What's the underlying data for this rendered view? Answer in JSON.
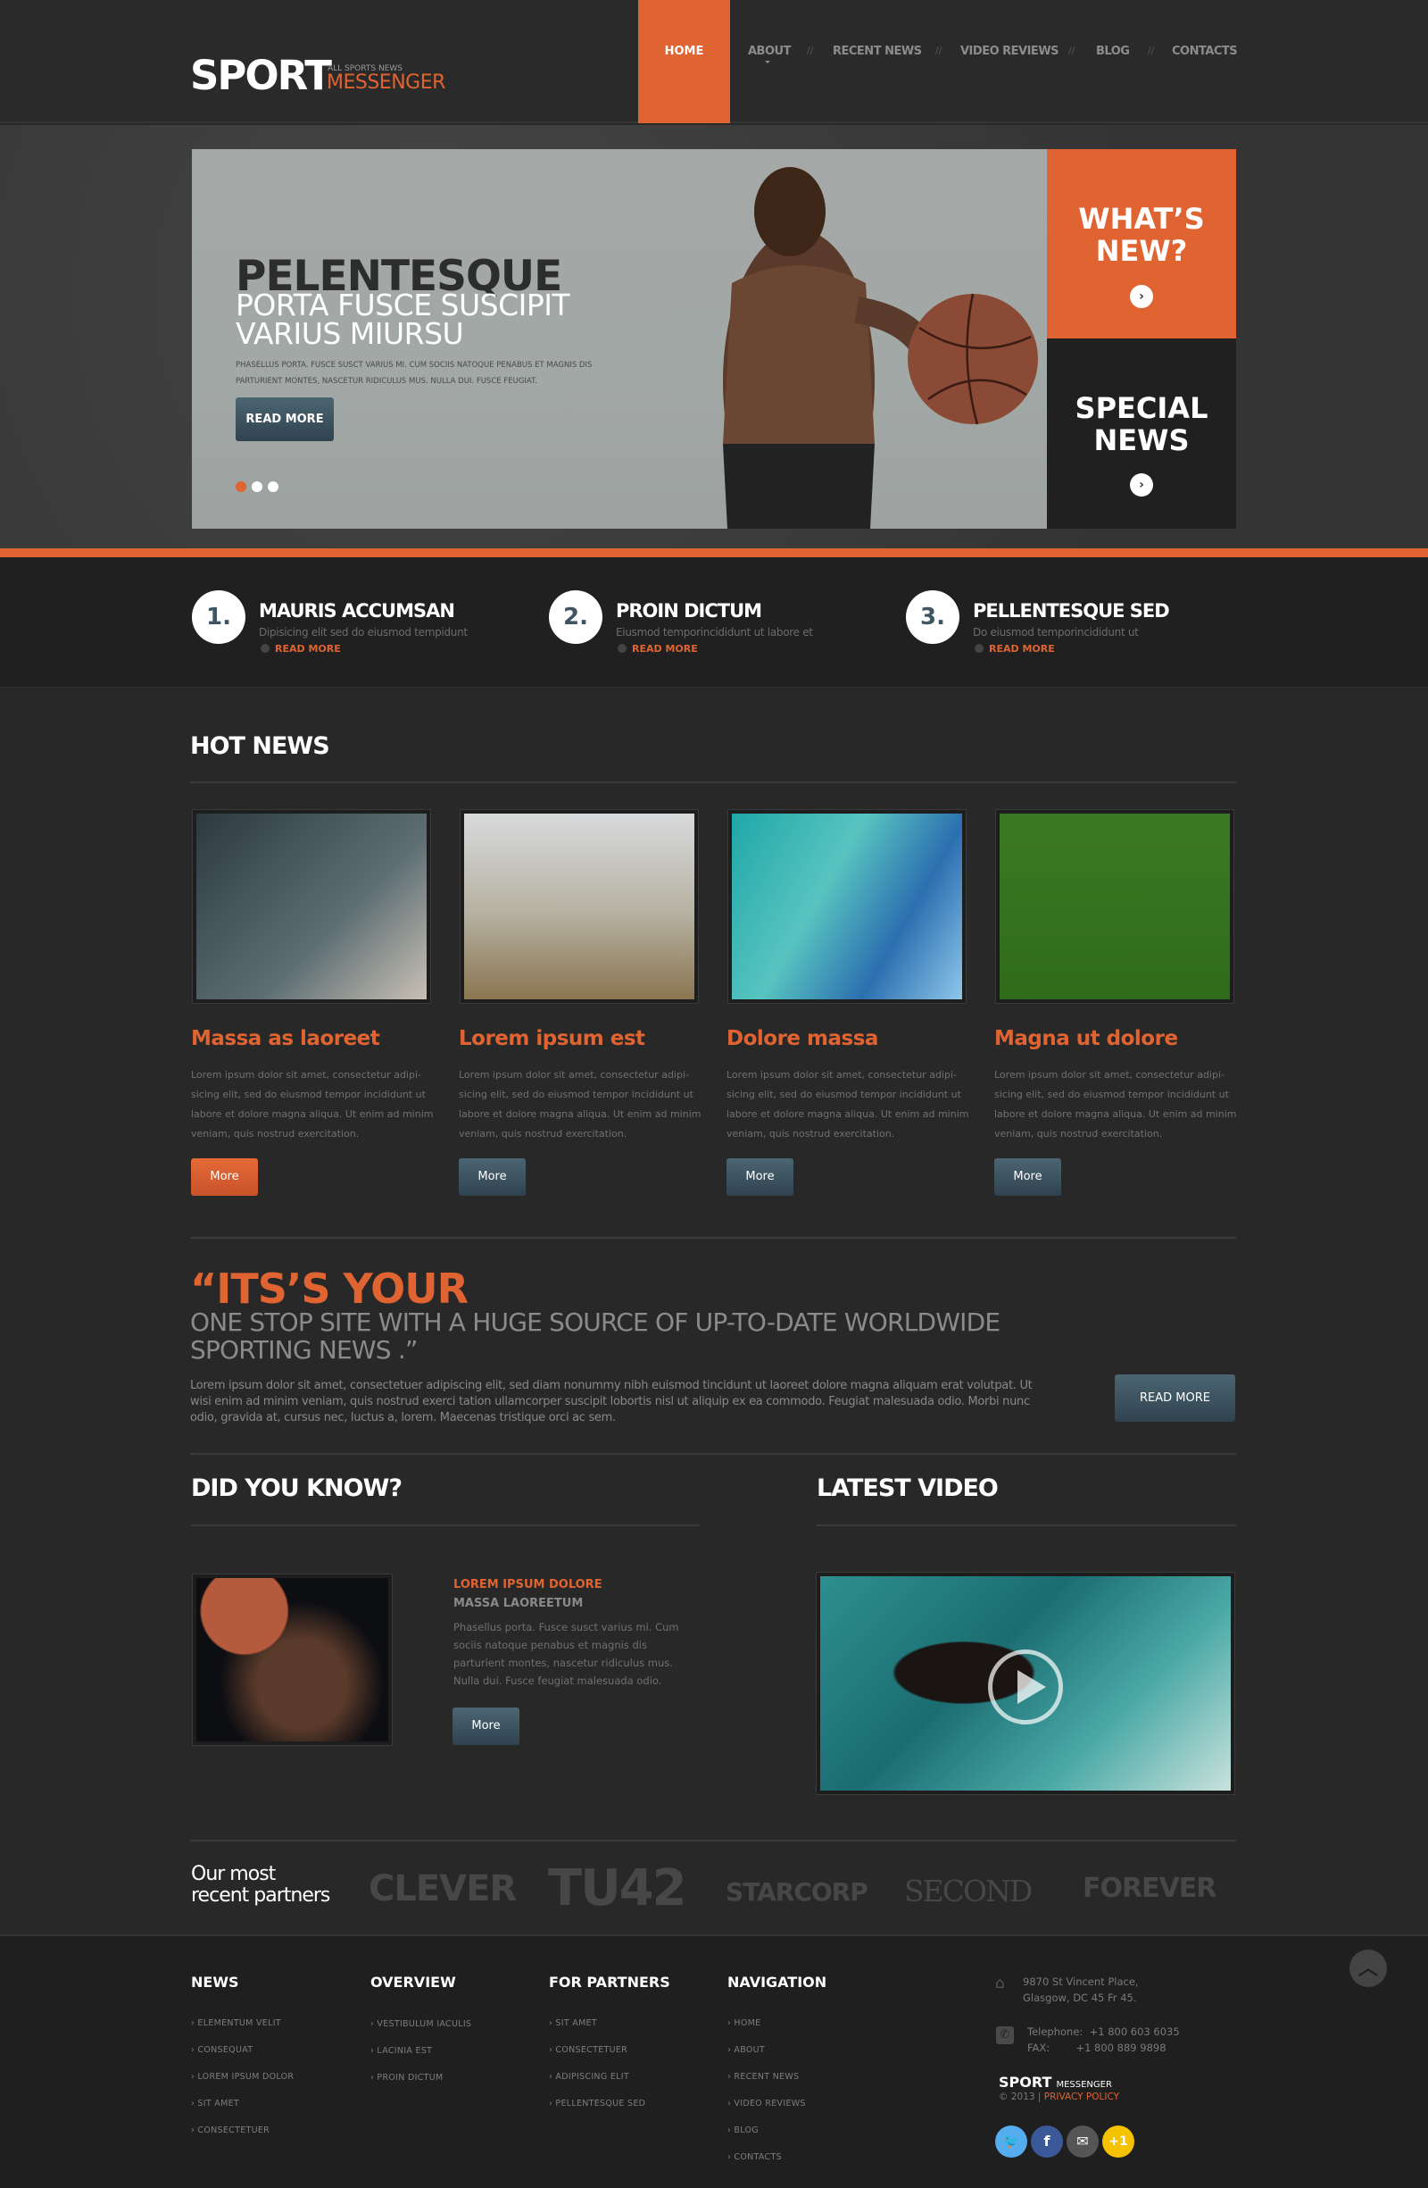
{
  "header": {
    "logo_main": "SPORT",
    "logo_tagline": "ALL SPORTS NEWS",
    "logo_sub": "MESSENGER",
    "nav": [
      "HOME",
      "ABOUT",
      "RECENT NEWS",
      "VIDEO REVIEWS",
      "BLOG",
      "CONTACTS"
    ],
    "nav_separator": "//",
    "active_nav": "HOME"
  },
  "hero": {
    "title": "PELENTESQUE",
    "subtitle": "PORTA FUSCE SUSCIPIT VARIUS MIURSU",
    "text": "Phasellus porta. Fusce susct varius mi. Cum sociis natoque penabus et magnis dis parturient montes, nascetur ridiculus mus. Nulla dui. Fusce feugiat.",
    "button": "READ MORE",
    "slides_total": 3,
    "slide_active": 1,
    "side_boxes": [
      {
        "title": "WHAT’S NEW?",
        "icon": "chevron-right-icon"
      },
      {
        "title": "SPECIAL NEWS",
        "icon": "chevron-right-icon"
      }
    ]
  },
  "features": [
    {
      "num": "1.",
      "title": "MAURIS ACCUMSAN",
      "desc": "Dipisicing elit sed do eiusmod tempidunt",
      "link": "READ MORE"
    },
    {
      "num": "2.",
      "title": "PROIN DICTUM",
      "desc": "Eiusmod temporincididunt ut labore et",
      "link": "READ MORE"
    },
    {
      "num": "3.",
      "title": "PELLENTESQUE SED",
      "desc": "Do eiusmod temporincididunt ut",
      "link": "READ MORE"
    }
  ],
  "hot_news": {
    "heading": "HOT NEWS",
    "items": [
      {
        "title": "Massa as laoreet",
        "image": "tennis-player",
        "body": "Lorem ipsum dolor sit amet, consectetur adipi-sicing elit, sed do eiusmod tempor incididunt ut labore et dolore magna aliqua. Ut enim ad minim veniam, quis nostrud exercitation.",
        "button": "More"
      },
      {
        "title": "Lorem ipsum est",
        "image": "motocross-rider",
        "body": "Lorem ipsum dolor sit amet, consectetur adipi-sicing elit, sed do eiusmod tempor incididunt ut labore et dolore magna aliqua. Ut enim ad minim veniam, quis nostrud exercitation.",
        "button": "More"
      },
      {
        "title": "Dolore massa",
        "image": "surfer",
        "body": "Lorem ipsum dolor sit amet, consectetur adipi-sicing elit, sed do eiusmod tempor incididunt ut labore et dolore magna aliqua. Ut enim ad minim veniam, quis nostrud exercitation.",
        "button": "More"
      },
      {
        "title": "Magna ut dolore",
        "image": "football-field",
        "body": "Lorem ipsum dolor sit amet, consectetur adipi-sicing elit, sed do eiusmod tempor incididunt ut labore et dolore magna aliqua. Ut enim ad minim veniam, quis nostrud exercitation.",
        "button": "More"
      }
    ]
  },
  "quote": {
    "big": "“ITS’S YOUR",
    "sub": "ONE STOP SITE WITH A HUGE SOURCE OF UP-TO-DATE WORLDWIDE SPORTING NEWS .”",
    "text": "Lorem ipsum dolor sit amet, consectetuer adipiscing elit, sed diam nonummy nibh euismod tincidunt ut laoreet dolore magna aliquam erat volutpat. Ut wisi enim ad minim veniam, quis nostrud exerci tation ullamcorper suscipit lobortis nisl ut aliquip ex ea commodo. Feugiat malesuada odio. Morbi nunc odio, gravida at, cursus nec, luctus a, lorem. Maecenas tristique orci ac sem.",
    "button": "READ MORE"
  },
  "did_you_know": {
    "heading": "DID YOU KNOW?",
    "title": "LOREM IPSUM DOLORE",
    "subtitle": "MASSA LAOREETUM",
    "text": "Phasellus porta. Fusce susct varius mi. Cum sociis natoque penabus et magnis dis parturient montes, nascetur ridiculus mus. Nulla dui. Fusce feugiat malesuada odio.",
    "button": "More"
  },
  "latest_video": {
    "heading": "LATEST VIDEO",
    "icon": "play-icon"
  },
  "partners": {
    "label": "Our most recent partners",
    "logos": [
      "CLEVER",
      "TU42",
      "STARCORP",
      "SECOND",
      "FOREVER"
    ]
  },
  "footer": {
    "columns": [
      {
        "heading": "NEWS",
        "links": [
          "ELEMENTUM VELIT",
          "CONSEQUAT",
          "LOREM IPSUM DOLOR",
          "SIT AMET",
          "CONSECTETUER"
        ]
      },
      {
        "heading": "OVERVIEW",
        "links": [
          "VESTIBULUM IACULIS",
          "LACINIA EST",
          "PROIN DICTUM"
        ]
      },
      {
        "heading": "FOR PARTNERS",
        "links": [
          "SIT AMET",
          "CONSECTETUER",
          "ADIPISCING ELIT",
          "PELLENTESQUE SED"
        ]
      },
      {
        "heading": "NAVIGATION",
        "links": [
          "HOME",
          "ABOUT",
          "RECENT NEWS",
          "VIDEO REVIEWS",
          "BLOG",
          "CONTACTS"
        ]
      }
    ],
    "address_line1": "9870 St Vincent Place,",
    "address_line2": "Glasgow, DC 45 Fr 45.",
    "telephone_label": "Telephone:",
    "telephone": "+1 800 603 6035",
    "fax_label": "FAX:",
    "fax": "+1 800 889 9898",
    "brand_main": "SPORT",
    "brand_sub": "MESSENGER",
    "copyright": "© 2013 |",
    "privacy": "PRIVACY POLICY",
    "social": [
      {
        "name": "twitter",
        "glyph": "🐦",
        "color": "#55acee"
      },
      {
        "name": "facebook",
        "glyph": "f",
        "color": "#3b5998"
      },
      {
        "name": "email",
        "glyph": "✉",
        "color": "#555555"
      },
      {
        "name": "google-plus",
        "glyph": "+1",
        "color": "#f5c200"
      }
    ]
  },
  "colors": {
    "accent": "#e06332",
    "slate_button": "#3e5563",
    "background": "#282828"
  }
}
